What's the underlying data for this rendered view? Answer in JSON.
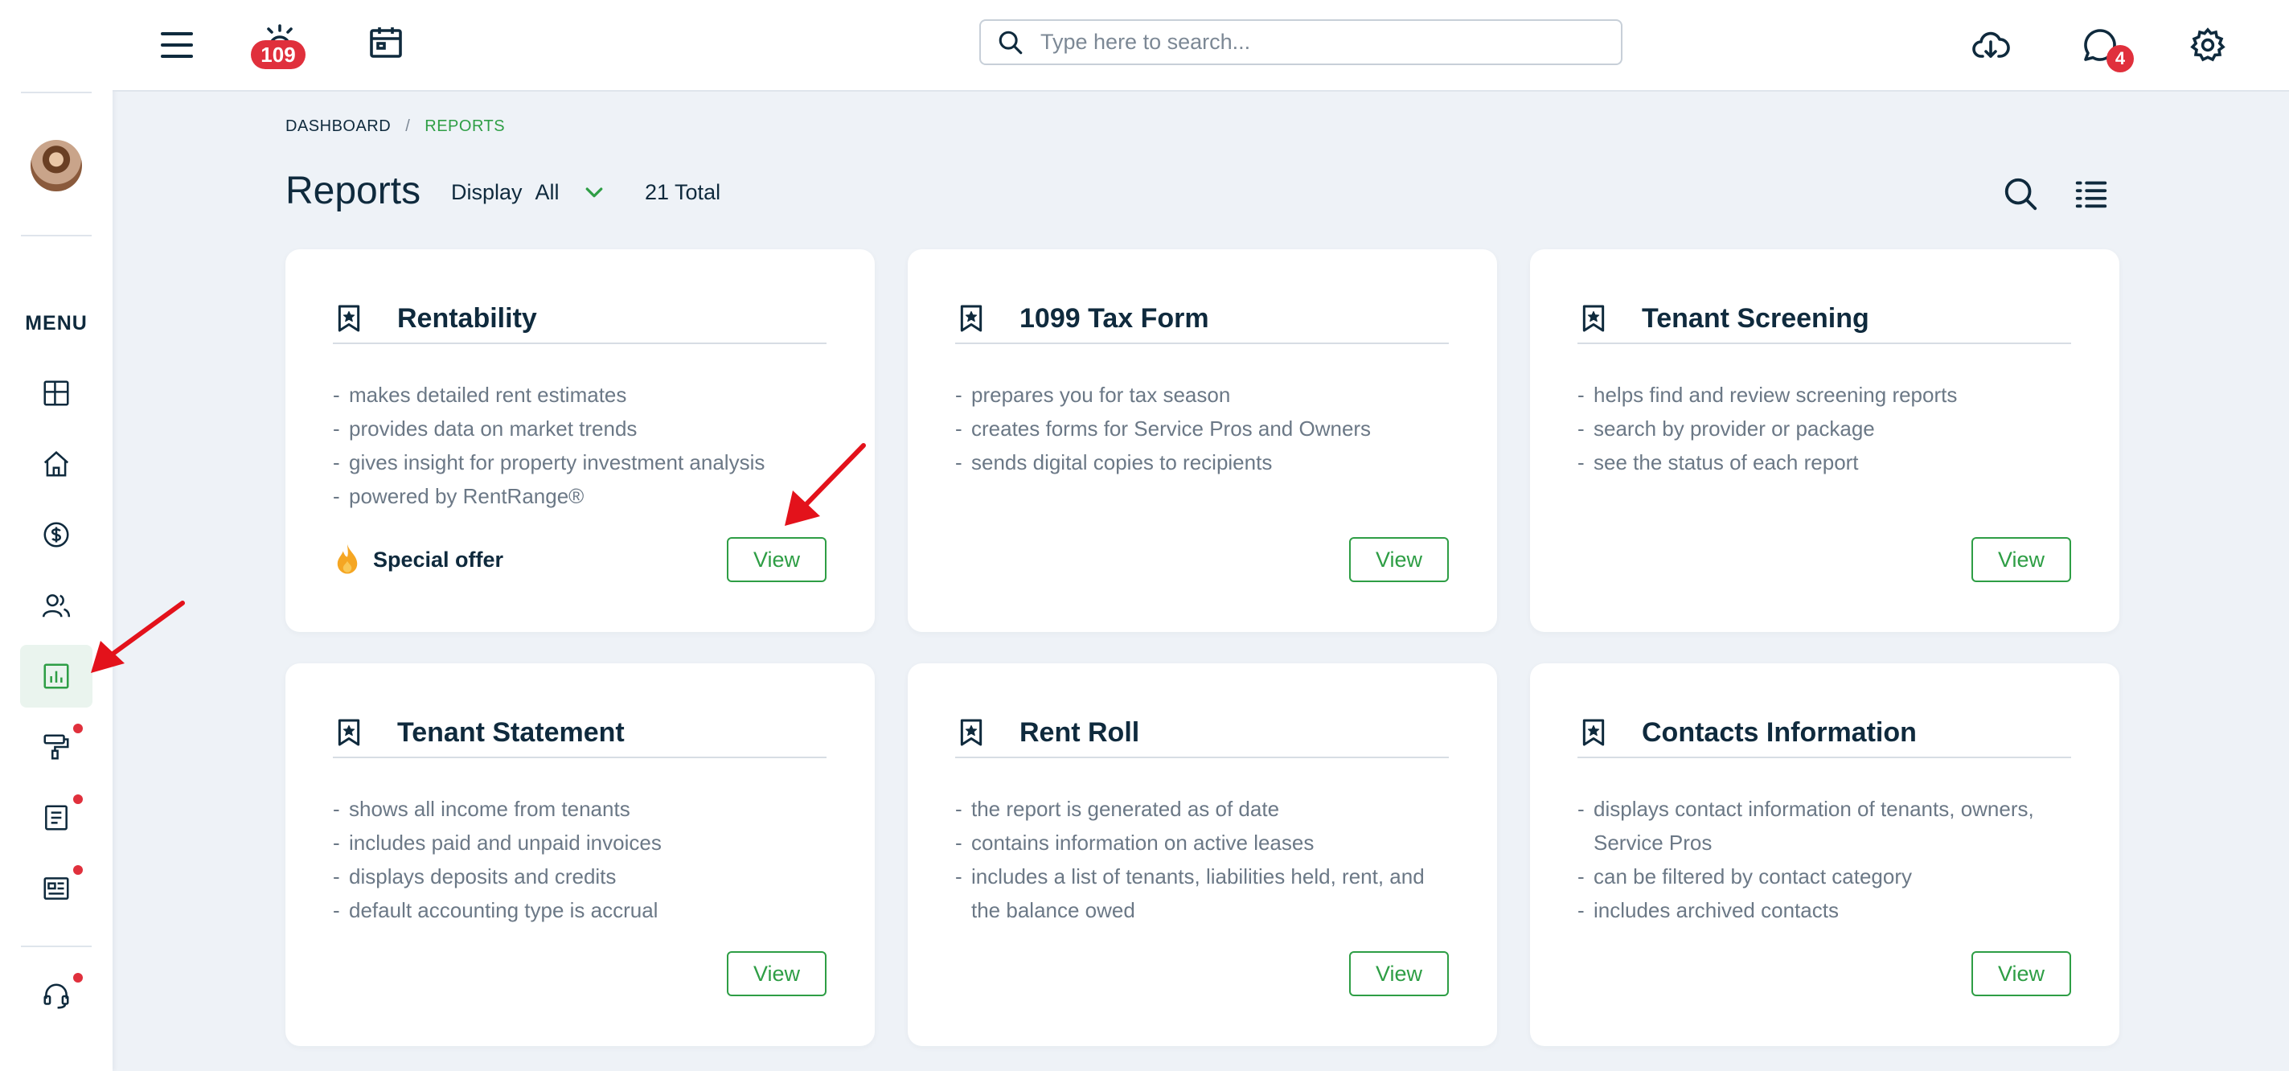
{
  "topbar": {
    "alarm_badge": "109",
    "chat_badge": "4",
    "search_placeholder": "Type here to search..."
  },
  "sidebar": {
    "menu_label": "MENU",
    "items": [
      {
        "icon": "dashboard-icon"
      },
      {
        "icon": "home-icon"
      },
      {
        "icon": "dollar-icon"
      },
      {
        "icon": "people-icon"
      },
      {
        "icon": "reports-icon",
        "active": true
      },
      {
        "icon": "paint-roller-icon",
        "dot": true
      },
      {
        "icon": "document-icon",
        "dot": true
      },
      {
        "icon": "news-icon",
        "dot": true
      },
      {
        "icon": "support-headset-icon",
        "dot": true
      }
    ]
  },
  "breadcrumb": {
    "home": "DASHBOARD",
    "separator": "/",
    "current": "REPORTS"
  },
  "header": {
    "title": "Reports",
    "display_label": "Display",
    "display_value": "All",
    "total": "21 Total"
  },
  "cards": [
    {
      "title": "Rentability",
      "items": [
        "makes detailed rent estimates",
        "provides data on market trends",
        "gives insight for property investment analysis",
        "powered by RentRange®"
      ],
      "offer": "Special offer",
      "button": "View"
    },
    {
      "title": "1099 Tax Form",
      "items": [
        "prepares you for tax season",
        "creates forms for Service Pros and Owners",
        "sends digital copies to recipients"
      ],
      "button": "View"
    },
    {
      "title": "Tenant Screening",
      "items": [
        "helps find and review screening reports",
        "search by provider or package",
        "see the status of each report"
      ],
      "button": "View"
    },
    {
      "title": "Tenant Statement",
      "items": [
        "shows all income from tenants",
        "includes paid and unpaid invoices",
        "displays deposits and credits",
        "default accounting type is accrual"
      ],
      "button": "View"
    },
    {
      "title": "Rent Roll",
      "items": [
        "the report is generated as of date",
        "contains information on active leases",
        "includes a list of tenants, liabilities held, rent, and the balance owed"
      ],
      "button": "View"
    },
    {
      "title": "Contacts Information",
      "items": [
        "displays contact information of tenants, owners, Service Pros",
        "can be filtered by contact category",
        "includes archived contacts"
      ],
      "button": "View"
    }
  ],
  "colors": {
    "accent": "#2e9e45",
    "text": "#0f2a3d",
    "muted": "#6b7886",
    "badge": "#e0303c",
    "background": "#eef2f7",
    "annotation_arrow": "#e3121b"
  }
}
